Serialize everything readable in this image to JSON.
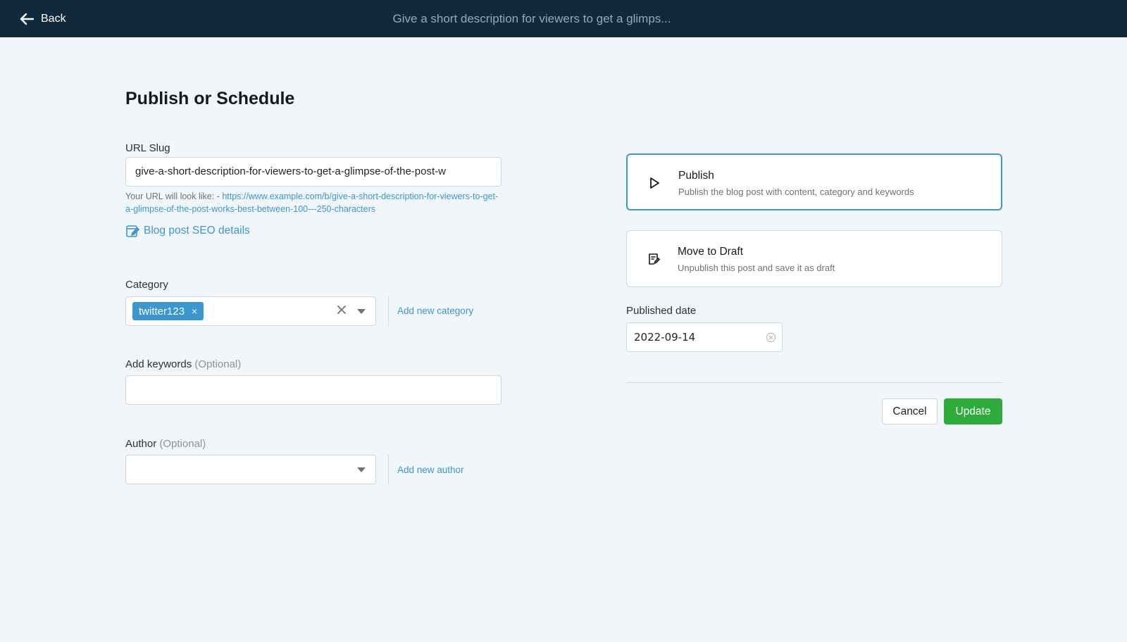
{
  "topbar": {
    "back_label": "Back",
    "title": "Give a short description for viewers to get a glimps..."
  },
  "page": {
    "title": "Publish or Schedule"
  },
  "url_slug": {
    "label": "URL Slug",
    "value": "give-a-short-description-for-viewers-to-get-a-glimpse-of-the-post-w",
    "hint_prefix": "Your URL will look like: - ",
    "hint_link": "https://www.example.com/b/give-a-short-description-for-viewers-to-get-a-glimpse-of-the-post-works-best-between-100---250-characters",
    "seo_link": "Blog post SEO details"
  },
  "category": {
    "label": "Category",
    "selected_tag": "twitter123",
    "tag_remove": "×",
    "add_link": "Add new category"
  },
  "keywords": {
    "label": "Add keywords",
    "optional": "(Optional)",
    "value": ""
  },
  "author": {
    "label": "Author",
    "optional": "(Optional)",
    "value": "",
    "add_link": "Add new author"
  },
  "actions": {
    "publish": {
      "title": "Publish",
      "description": "Publish the blog post with content, category and keywords"
    },
    "draft": {
      "title": "Move to Draft",
      "description": "Unpublish this post and save it as draft"
    }
  },
  "published_date": {
    "label": "Published date",
    "value": "2022-09-14"
  },
  "buttons": {
    "cancel": "Cancel",
    "update": "Update"
  },
  "colors": {
    "topbar": "#10293b",
    "accent": "#3a97d0",
    "update": "#2dac3b",
    "background": "#f1f6fa"
  },
  "icons": {
    "back": "arrow-left-icon",
    "seo": "edit-document-icon",
    "publish": "play-icon",
    "draft": "draft-icon",
    "clear": "close-icon",
    "dropdown": "chevron-down-icon"
  }
}
